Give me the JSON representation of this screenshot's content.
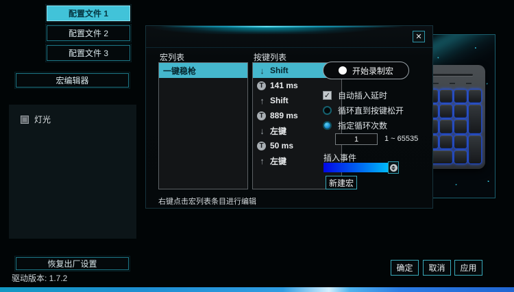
{
  "colors": {
    "accent": "#41c3d9",
    "selection": "#45b7cd",
    "button_border": "#1d7888",
    "event_gradient_start": "#0207e6",
    "event_gradient_end": "#00d9fa",
    "key_glow": "#2d5fff"
  },
  "sidebar": {
    "profiles": [
      {
        "label": "配置文件 1",
        "active": true
      },
      {
        "label": "配置文件 2",
        "active": false
      },
      {
        "label": "配置文件 3",
        "active": false
      }
    ],
    "macro_editor_label": "宏编辑器",
    "lighting_label": "灯光",
    "lighting_checked": false,
    "restore_label": "恢复出厂设置",
    "version_label": "驱动版本: 1.7.2"
  },
  "dialog": {
    "close_glyph": "✕",
    "macro_list": {
      "title": "宏列表",
      "items": [
        {
          "label": "一键稳枪",
          "selected": true
        }
      ]
    },
    "key_list": {
      "title": "按键列表",
      "items": [
        {
          "icon": "down-arrow",
          "label": "Shift",
          "selected": true
        },
        {
          "icon": "timer",
          "label": "141 ms",
          "selected": false
        },
        {
          "icon": "up-arrow",
          "label": "Shift",
          "selected": false
        },
        {
          "icon": "timer",
          "label": "889 ms",
          "selected": false
        },
        {
          "icon": "down-arrow",
          "label": "左键",
          "selected": false
        },
        {
          "icon": "timer",
          "label": "50 ms",
          "selected": false
        },
        {
          "icon": "up-arrow",
          "label": "左键",
          "selected": false
        }
      ]
    },
    "controls": {
      "record_button_label": "开始录制宏",
      "auto_delay_label": "自动插入延时",
      "auto_delay_checked": true,
      "check_glyph": "✓",
      "loop_until_release_label": "循环直到按键松开",
      "loop_until_release_selected": false,
      "loop_count_label": "指定循环次数",
      "loop_count_selected": true,
      "count_value": "1",
      "count_range": "1 ~ 65535",
      "insert_event_label": "插入事件",
      "new_macro_label": "新建宏"
    },
    "hint": "右键点击宏列表条目进行编辑"
  },
  "footer": {
    "ok_label": "确定",
    "cancel_label": "取消",
    "apply_label": "应用"
  }
}
